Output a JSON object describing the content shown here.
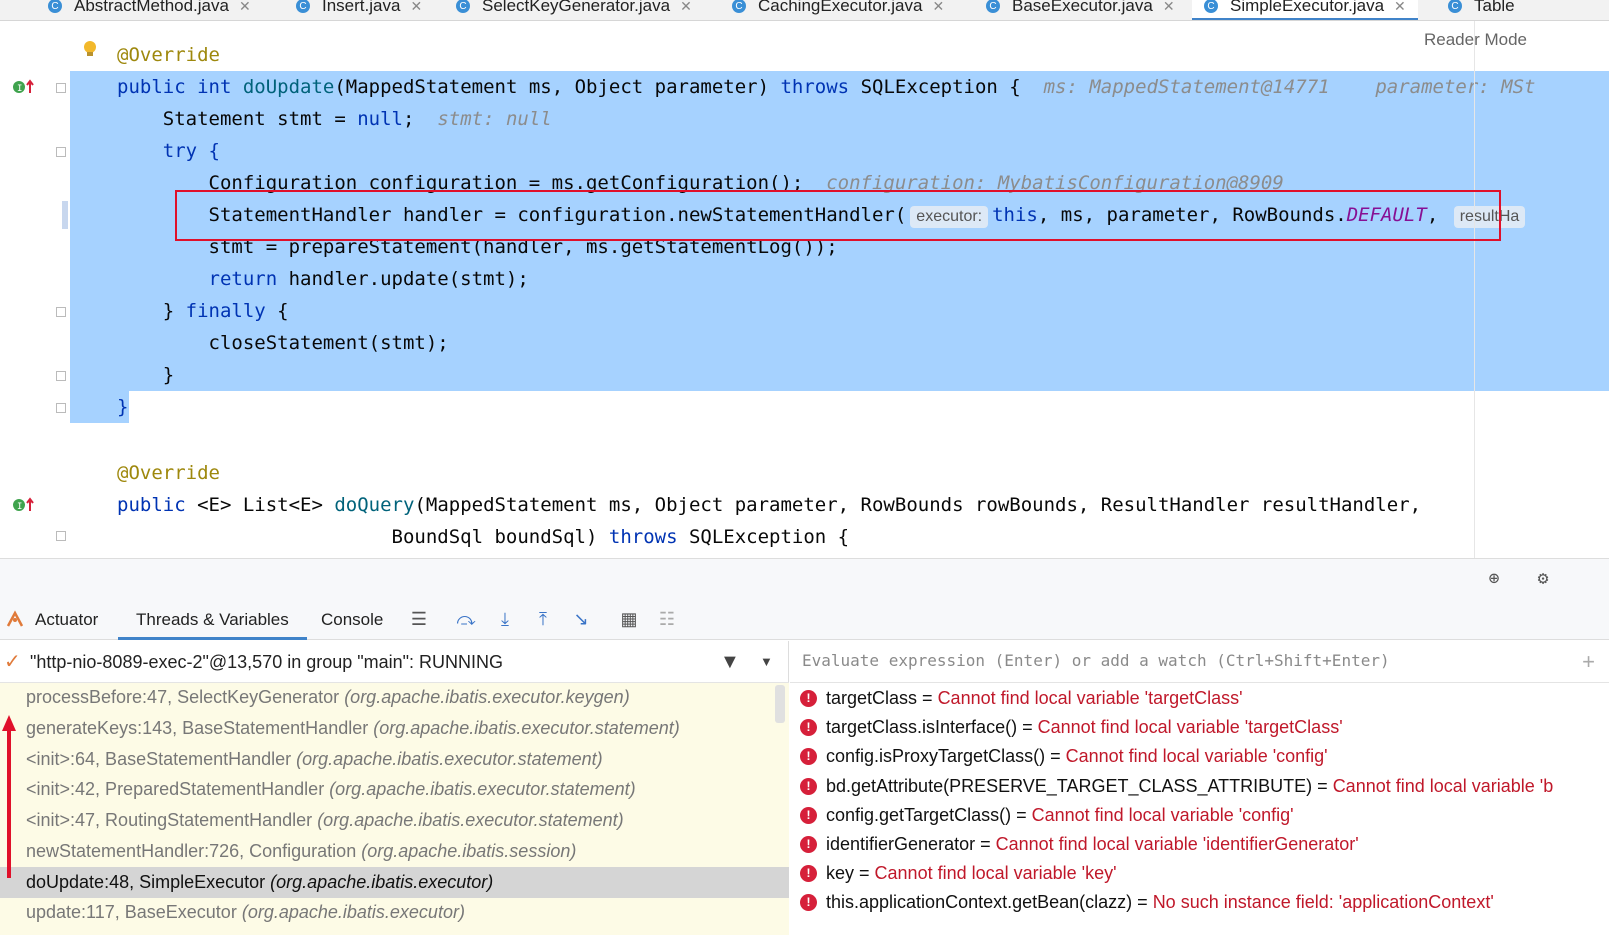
{
  "tabs": [
    {
      "label": "AbstractMethod.java",
      "active": false
    },
    {
      "label": "Insert.java",
      "active": false
    },
    {
      "label": "SelectKeyGenerator.java",
      "active": false
    },
    {
      "label": "CachingExecutor.java",
      "active": false
    },
    {
      "label": "BaseExecutor.java",
      "active": false
    },
    {
      "label": "SimpleExecutor.java",
      "active": true
    },
    {
      "label": "Table",
      "active": false
    }
  ],
  "editor": {
    "reader_mode": "Reader Mode",
    "lines": {
      "l1": "@Override",
      "l2_a": "public int ",
      "l2_fn": "doUpdate",
      "l2_b": "(MappedStatement ms, Object parameter) ",
      "l2_throws": "throws",
      "l2_c": " SQLException {",
      "l2_hint": "ms: MappedStatement@14771    parameter: MSt",
      "l3_a": "    Statement stmt = ",
      "l3_null": "null",
      "l3_b": ";",
      "l3_hint": "stmt: null",
      "l4": "    try {",
      "l5_a": "        Configuration configuration = ms.getConfiguration();",
      "l5_hint": "configuration: MybatisConfiguration@8909",
      "l6_a": "        StatementHandler handler = configuration.newStatementHandler(",
      "l6_param1": "executor:",
      "l6_this": "this",
      "l6_b": ", ms, parameter, RowBounds.",
      "l6_default": "DEFAULT",
      "l6_c": ",",
      "l6_param2": "resultHa",
      "l7": "        stmt = prepareStatement(handler, ms.getStatementLog());",
      "l8_ret": "return",
      "l8_b": " handler.update(stmt);",
      "l9_a": "    } ",
      "l9_finally": "finally",
      "l9_b": " {",
      "l10": "        closeStatement(stmt);",
      "l11": "    }",
      "l12": "}",
      "l13": "@Override",
      "l14_pub": "public",
      "l14_a": " <E> List<E> ",
      "l14_fn": "doQuery",
      "l14_b": "(MappedStatement ms, Object parameter, RowBounds rowBounds, ResultHandler resultHandler,",
      "l15_a": "                        BoundSql boundSql) ",
      "l15_throws": "throws",
      "l15_b": " SQLException {"
    }
  },
  "debugger": {
    "tabs": {
      "actuator": "Actuator",
      "threads": "Threads & Variables",
      "console": "Console"
    },
    "thread_label": "\"http-nio-8089-exec-2\"@13,570 in group \"main\": RUNNING",
    "eval_placeholder": "Evaluate expression (Enter) or add a watch (Ctrl+Shift+Enter)",
    "frames": [
      {
        "method": "processBefore:47, SelectKeyGenerator ",
        "pkg": "(org.apache.ibatis.executor.keygen)"
      },
      {
        "method": "generateKeys:143, BaseStatementHandler ",
        "pkg": "(org.apache.ibatis.executor.statement)"
      },
      {
        "method": "<init>:64, BaseStatementHandler ",
        "pkg": "(org.apache.ibatis.executor.statement)"
      },
      {
        "method": "<init>:42, PreparedStatementHandler ",
        "pkg": "(org.apache.ibatis.executor.statement)"
      },
      {
        "method": "<init>:47, RoutingStatementHandler ",
        "pkg": "(org.apache.ibatis.executor.statement)"
      },
      {
        "method": "newStatementHandler:726, Configuration ",
        "pkg": "(org.apache.ibatis.session)"
      },
      {
        "method": "doUpdate:48, SimpleExecutor ",
        "pkg": "(org.apache.ibatis.executor)"
      },
      {
        "method": "update:117, BaseExecutor ",
        "pkg": "(org.apache.ibatis.executor)"
      }
    ],
    "watches": [
      {
        "expr": "targetClass = ",
        "msg": "Cannot find local variable 'targetClass'"
      },
      {
        "expr": "targetClass.isInterface() = ",
        "msg": "Cannot find local variable 'targetClass'"
      },
      {
        "expr": "config.isProxyTargetClass() = ",
        "msg": "Cannot find local variable 'config'"
      },
      {
        "expr": "bd.getAttribute(PRESERVE_TARGET_CLASS_ATTRIBUTE) = ",
        "msg": "Cannot find local variable 'b"
      },
      {
        "expr": "config.getTargetClass() = ",
        "msg": "Cannot find local variable 'config'"
      },
      {
        "expr": "identifierGenerator = ",
        "msg": "Cannot find local variable 'identifierGenerator'"
      },
      {
        "expr": "key = ",
        "msg": "Cannot find local variable 'key'"
      },
      {
        "expr": "this.applicationContext.getBean(clazz) = ",
        "msg": "No such instance field: 'applicationContext'"
      }
    ]
  }
}
